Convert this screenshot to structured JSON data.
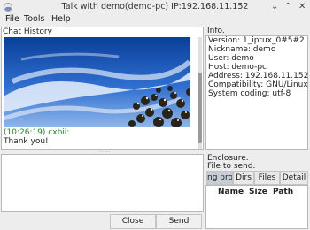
{
  "window": {
    "title": "Talk with demo(demo-pc) IP:192.168.11.152",
    "minimize_glyph": "⌄",
    "maximize_glyph": "⌃",
    "close_glyph": "✕",
    "app_icon": "chat-app-icon"
  },
  "menu": {
    "file": "File",
    "tools": "Tools",
    "help": "Help"
  },
  "chat": {
    "label": "Chat History",
    "image_icon": "sky-tree-image",
    "message": {
      "time_sender": "(10:26:19) cxbii:",
      "text": "Thank you!"
    }
  },
  "input": {
    "value": "",
    "close_label": "Close",
    "send_label": "Send"
  },
  "info": {
    "label": "Info.",
    "lines": [
      "Version: 1_iptux_0#5#2",
      "Nickname: demo",
      "User: demo",
      "Host: demo-pc",
      "Address: 192.168.11.152",
      "Compatibility: GNU/Linux",
      "System coding: utf-8"
    ]
  },
  "enclosure": {
    "label": "Enclosure.",
    "sublabel": "File to send.",
    "tabs": [
      "ng pro",
      "Dirs",
      "Files",
      "Detail"
    ],
    "active_tab": 0,
    "columns": [
      "Name",
      "Size",
      "Path"
    ]
  },
  "colors": {
    "time_green": "#1e8a1e",
    "active_tab": "#c6cdd6"
  }
}
